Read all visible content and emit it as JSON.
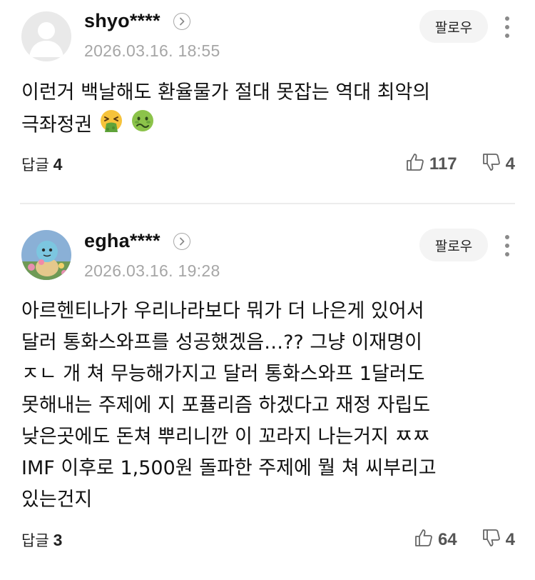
{
  "comments": [
    {
      "username": "shyo****",
      "date": "2026.03.16. 18:55",
      "follow_label": "팔로우",
      "body_lines": [
        "이런거 백날해도 환율물가 절대 못잡는 역대 최악의",
        "극좌정권"
      ],
      "emojis": [
        "vomiting-face-icon",
        "nauseated-face-icon"
      ],
      "reply_label": "답글",
      "reply_count": "4",
      "likes": "117",
      "dislikes": "4"
    },
    {
      "username": "egha****",
      "date": "2026.03.16. 19:28",
      "follow_label": "팔로우",
      "body_lines": [
        "아르헨티나가 우리나라보다 뭐가 더 나은게 있어서",
        "달러 통화스와프를 성공했겠음…?? 그냥 이재명이",
        "ㅈㄴ 개 쳐 무능해가지고 달러 통화스와프 1달러도",
        "못해내는 주제에 지 포퓰리즘 하겠다고 재정 자립도",
        "낮은곳에도 돈쳐 뿌리니깐 이 꼬라지 나는거지 ㅉㅉ",
        "IMF 이후로 1,500원 돌파한 주제에 뭘 쳐 씨부리고",
        "있는건지"
      ],
      "reply_label": "답글",
      "reply_count": "3",
      "likes": "64",
      "dislikes": "4"
    }
  ]
}
